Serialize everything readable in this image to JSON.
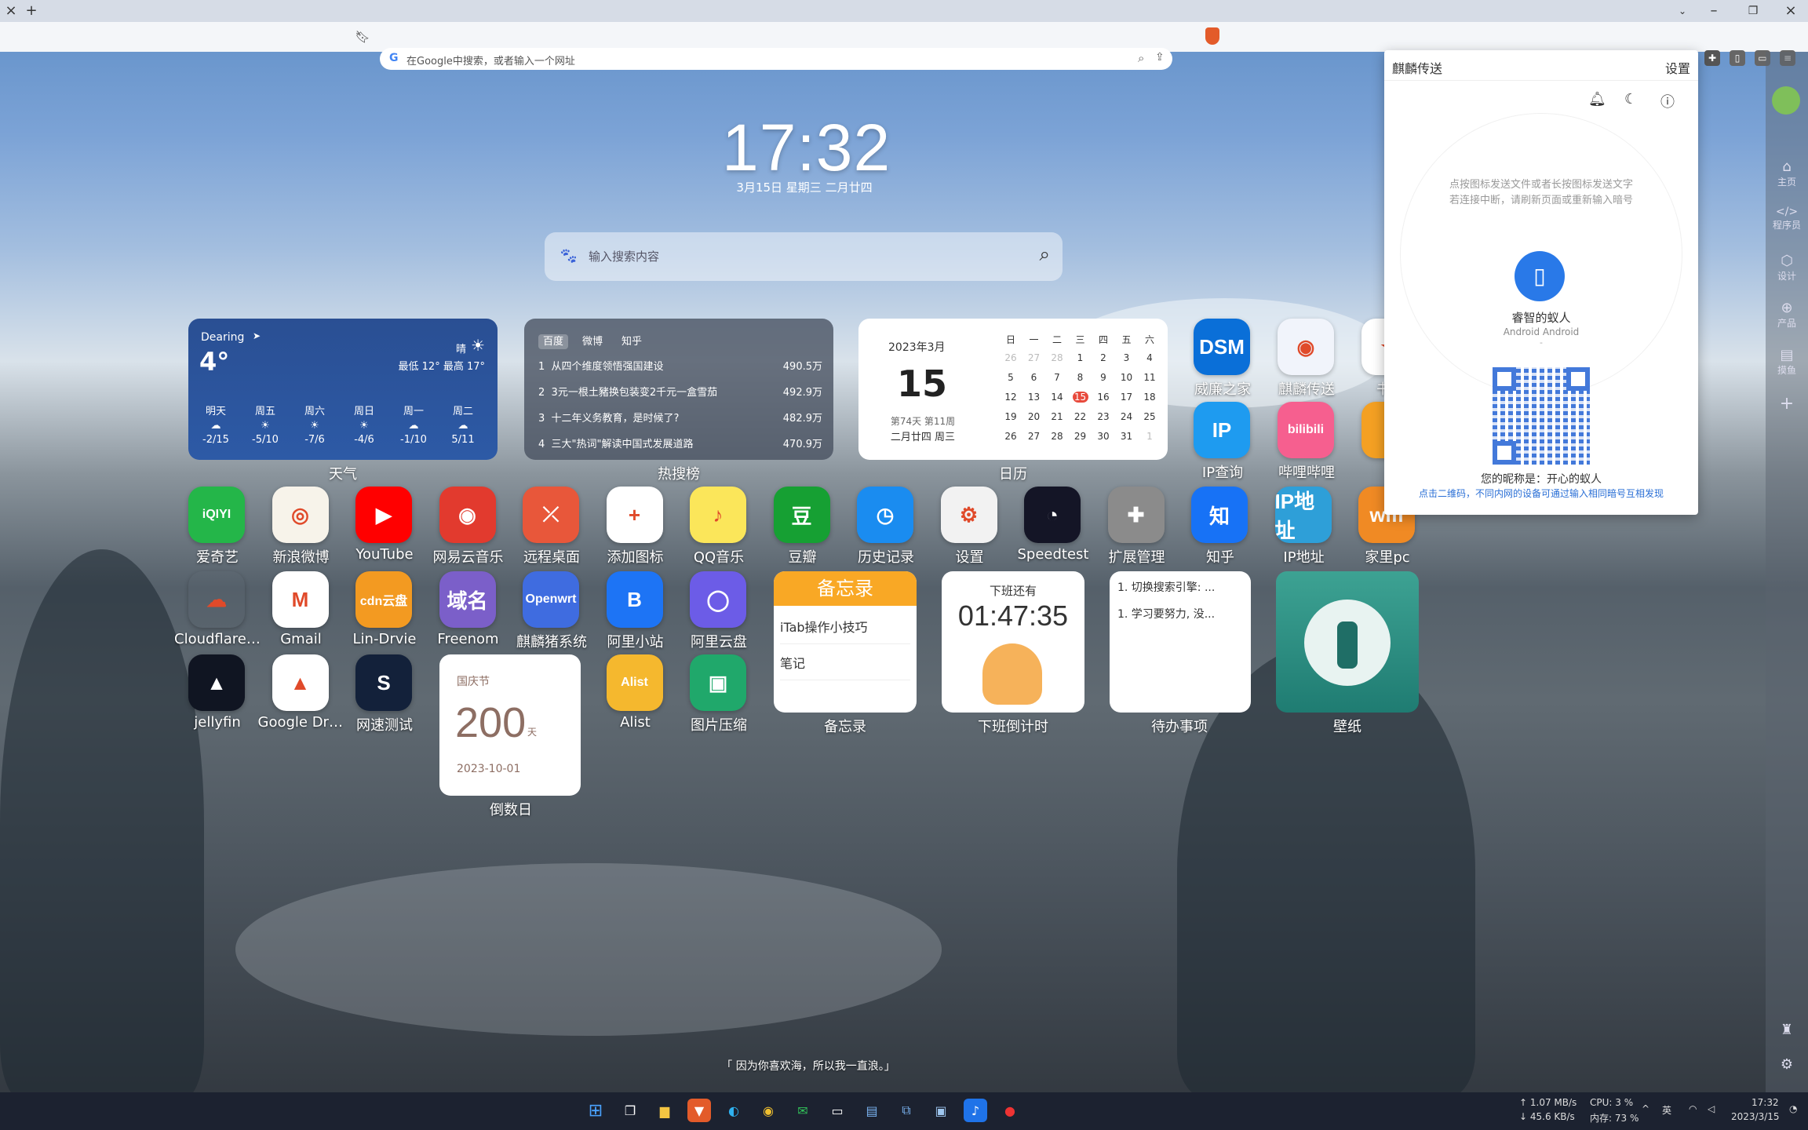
{
  "browser": {
    "tab_close": "×",
    "new_tab": "+",
    "omnibox_placeholder": "在Google中搜索，或者输入一个网址",
    "omnibox_g": "G"
  },
  "clock": {
    "time": "17:32",
    "date": "3月15日 星期三 二月廿四"
  },
  "search": {
    "placeholder": "输入搜索内容"
  },
  "weather": {
    "location": "Dearing",
    "temp": "4°",
    "condition": "晴",
    "range": "最低 12° 最高 17°",
    "forecast": [
      {
        "day": "明天",
        "range": "-2/15"
      },
      {
        "day": "周五",
        "range": "-5/10"
      },
      {
        "day": "周六",
        "range": "-7/6"
      },
      {
        "day": "周日",
        "range": "-4/6"
      },
      {
        "day": "周一",
        "range": "-1/10"
      },
      {
        "day": "周二",
        "range": "5/11"
      }
    ],
    "label": "天气"
  },
  "hot": {
    "tabs": [
      "百度",
      "微博",
      "知乎"
    ],
    "items": [
      {
        "rank": "1",
        "title": "从四个维度领悟强国建设",
        "value": "490.5万"
      },
      {
        "rank": "2",
        "title": "3元一根土豬换包装变2千元一盒雪茄",
        "value": "492.9万"
      },
      {
        "rank": "3",
        "title": "十二年义务教育，是时候了?",
        "value": "482.9万"
      },
      {
        "rank": "4",
        "title": "三大\"热词\"解读中国式发展道路",
        "value": "470.9万"
      }
    ],
    "label": "热搜榜"
  },
  "calendar": {
    "month": "2023年3月",
    "day": "15",
    "info1": "第74天 第11周",
    "info2": "二月廿四 周三",
    "weekdays": [
      "日",
      "一",
      "二",
      "三",
      "四",
      "五",
      "六"
    ],
    "days": [
      [
        "26",
        "27",
        "28",
        "1",
        "2",
        "3",
        "4"
      ],
      [
        "5",
        "6",
        "7",
        "8",
        "9",
        "10",
        "11"
      ],
      [
        "12",
        "13",
        "14",
        "15",
        "16",
        "17",
        "18"
      ],
      [
        "19",
        "20",
        "21",
        "22",
        "23",
        "24",
        "25"
      ],
      [
        "26",
        "27",
        "28",
        "29",
        "30",
        "31",
        "1"
      ]
    ],
    "label": "日历"
  },
  "apps_row1": [
    {
      "name": "威廉之家",
      "text": "DSM",
      "color": "#0a6fd8"
    },
    {
      "name": "麒麟传送",
      "text": "◉",
      "color": "#f1f4fb"
    },
    {
      "name": "书签",
      "text": "★",
      "color": "#ffffff"
    }
  ],
  "apps_row2": [
    {
      "name": "IP查询",
      "text": "IP",
      "color": "#1e9bf0"
    },
    {
      "name": "哔哩哔哩",
      "text": "bilibili",
      "color": "#f65f8f"
    },
    {
      "name": "",
      "text": "",
      "color": "#f4a023"
    }
  ],
  "apps_row3": [
    {
      "name": "爱奇艺",
      "text": "iQIYI",
      "color": "#24b649"
    },
    {
      "name": "新浪微博",
      "text": "◎",
      "color": "#f7f3ea"
    },
    {
      "name": "YouTube",
      "text": "▶",
      "color": "#ff0000"
    },
    {
      "name": "网易云音乐",
      "text": "◉",
      "color": "#e23a2e"
    },
    {
      "name": "远程桌面",
      "text": "⤫",
      "color": "#e8573a"
    },
    {
      "name": "添加图标",
      "text": "+",
      "color": "#ffffff"
    },
    {
      "name": "QQ音乐",
      "text": "♪",
      "color": "#fbe65a"
    },
    {
      "name": "豆瓣",
      "text": "豆",
      "color": "#16a033"
    },
    {
      "name": "历史记录",
      "text": "◷",
      "color": "#1a8cf0"
    },
    {
      "name": "设置",
      "text": "⚙",
      "color": "#f2f2f2"
    },
    {
      "name": "Speedtest",
      "text": "◔",
      "color": "#141526"
    },
    {
      "name": "扩展管理",
      "text": "✚",
      "color": "#8b8b8b"
    },
    {
      "name": "知乎",
      "text": "知",
      "color": "#1772f6"
    },
    {
      "name": "IP地址",
      "text": "IP地址",
      "color": "#2e9fd8"
    },
    {
      "name": "家里pc",
      "text": "wifi",
      "color": "#f08a24"
    }
  ],
  "apps_row4": [
    {
      "name": "Cloudflare ...",
      "text": "☁",
      "color": "transparent"
    },
    {
      "name": "Gmail",
      "text": "M",
      "color": "#ffffff"
    },
    {
      "name": "Lin-Drvie",
      "text": "cdn云盘",
      "color": "#f39a21"
    },
    {
      "name": "Freenom",
      "text": "域名",
      "color": "#7b5fc9"
    },
    {
      "name": "麒麟猪系统",
      "text": "Openwrt",
      "color": "#3f6ce0"
    },
    {
      "name": "阿里小站",
      "text": "B",
      "color": "#1d74f5"
    },
    {
      "name": "阿里云盘",
      "text": "◯",
      "color": "#6c5ce7"
    }
  ],
  "apps_row5": [
    {
      "name": "jellyfin",
      "text": "▲",
      "color": "#101522"
    },
    {
      "name": "Google Drive",
      "text": "▲",
      "color": "#ffffff"
    },
    {
      "name": "网速测试",
      "text": "S",
      "color": "#13213a"
    },
    {
      "name": "Alist",
      "text": "Alist",
      "color": "#f5b82e"
    },
    {
      "name": "图片压缩",
      "text": "▣",
      "color": "#20a86b"
    }
  ],
  "memo": {
    "header": "备忘录",
    "items": [
      "iTab操作小技巧",
      "笔记"
    ],
    "label": "备忘录"
  },
  "offwork": {
    "title": "下班还有",
    "time": "01:47:35",
    "label": "下班倒计时"
  },
  "todo": {
    "items": [
      "1. 切换搜索引擎: ...",
      "1. 学习要努力, 没..."
    ],
    "label": "待办事项"
  },
  "countdown": {
    "event": "国庆节",
    "days": "200",
    "unit": "天",
    "date": "2023-10-01",
    "label": "倒数日"
  },
  "wallpaper": {
    "label": "壁纸"
  },
  "quote": "「 因为你喜欢海，所以我一直浪。」",
  "panel": {
    "title": "麒麟传送",
    "settings": "设置",
    "hint1": "点按图标发送文件或者长按图标发送文字",
    "hint2": "若连接中断，请刷新页面或重新输入暗号",
    "device_name": "睿智的蚁人",
    "device_type": "Android Android",
    "device_extra": "-",
    "nickname": "您的昵称是：开心的蚁人",
    "link": "点击二维码，不同内网的设备可通过输入相同暗号互相发现"
  },
  "sidebar": {
    "items": [
      {
        "icon": "⌂",
        "label": "主页"
      },
      {
        "icon": "</>",
        "label": "程序员"
      },
      {
        "icon": "⬡",
        "label": "设计"
      },
      {
        "icon": "⊕",
        "label": "产品"
      },
      {
        "icon": "▤",
        "label": "摸鱼"
      }
    ],
    "add": "+"
  },
  "tray": {
    "net_up": "↑ 1.07 MB/s",
    "net_down": "↓ 45.6 KB/s",
    "cpu": "CPU: 3 %",
    "mem": "内存: 73 %",
    "ime": "英",
    "time": "17:32",
    "date": "2023/3/15"
  }
}
